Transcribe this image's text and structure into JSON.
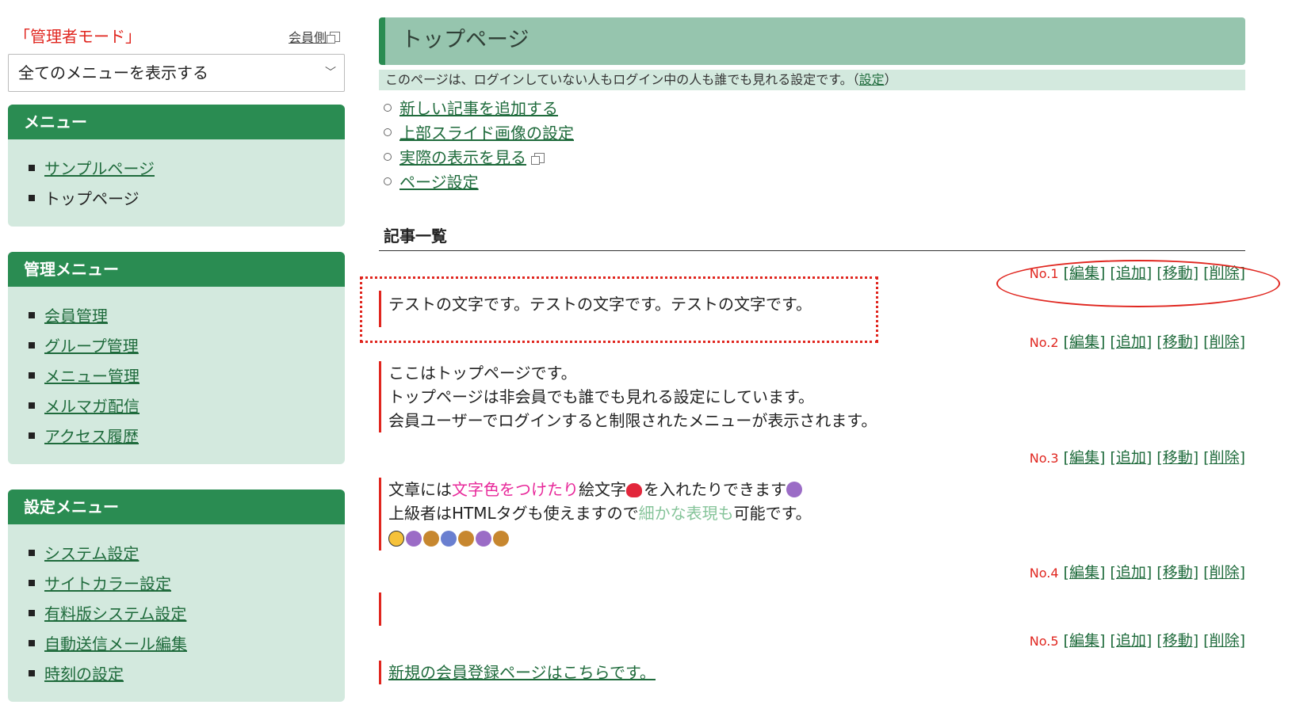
{
  "sidebar": {
    "admin_mode": "「管理者モード」",
    "member_side_link": "会員側",
    "select_value": "全てのメニューを表示する",
    "menu": {
      "title": "メニュー",
      "items": [
        {
          "label": "サンプルページ",
          "link": true
        },
        {
          "label": "トップページ",
          "link": false
        }
      ]
    },
    "admin_menu": {
      "title": "管理メニュー",
      "items": [
        "会員管理",
        "グループ管理",
        "メニュー管理",
        "メルマガ配信",
        "アクセス履歴"
      ]
    },
    "settings_menu": {
      "title": "設定メニュー",
      "items": [
        "システム設定",
        "サイトカラー設定",
        "有料版システム設定",
        "自動送信メール編集",
        "時刻の設定"
      ]
    }
  },
  "main": {
    "title": "トップページ",
    "notice_text": "このページは、ログインしていない人もログイン中の人も誰でも見れる設定です。（",
    "notice_link": "設定",
    "notice_end": "）",
    "actions": [
      "新しい記事を追加する",
      "上部スライド画像の設定",
      "実際の表示を見る",
      "ページ設定"
    ],
    "section_title": "記事一覧",
    "controls": {
      "edit": "[編集]",
      "add": "[追加]",
      "move": "[移動]",
      "delete": "[削除]"
    },
    "articles": [
      {
        "no": "No.1",
        "lines": [
          "テストの文字です。テストの文字です。テストの文字です。"
        ]
      },
      {
        "no": "No.2",
        "lines": [
          "ここはトップページです。",
          "トップページは非会員でも誰でも見れる設定にしています。",
          "会員ユーザーでログインすると制限されたメニューが表示されます。"
        ]
      },
      {
        "no": "No.3",
        "line1_a": "文章には",
        "line1_pink": "文字色をつけたり",
        "line1_b": "絵文字",
        "line1_c": "を入れたりできます",
        "line2_a": "上級者はHTMLタグも使えますので",
        "line2_green": "細かな表現も",
        "line2_b": "可能です。"
      },
      {
        "no": "No.4",
        "lines": []
      },
      {
        "no": "No.5",
        "link": "新規の会員登録ページはこちらです。"
      }
    ]
  },
  "colors": {
    "accent_green": "#2a8c52",
    "header_green": "#96c5ae",
    "light_green": "#d3e9de",
    "red": "#e0261f",
    "pink": "#e8289a"
  }
}
